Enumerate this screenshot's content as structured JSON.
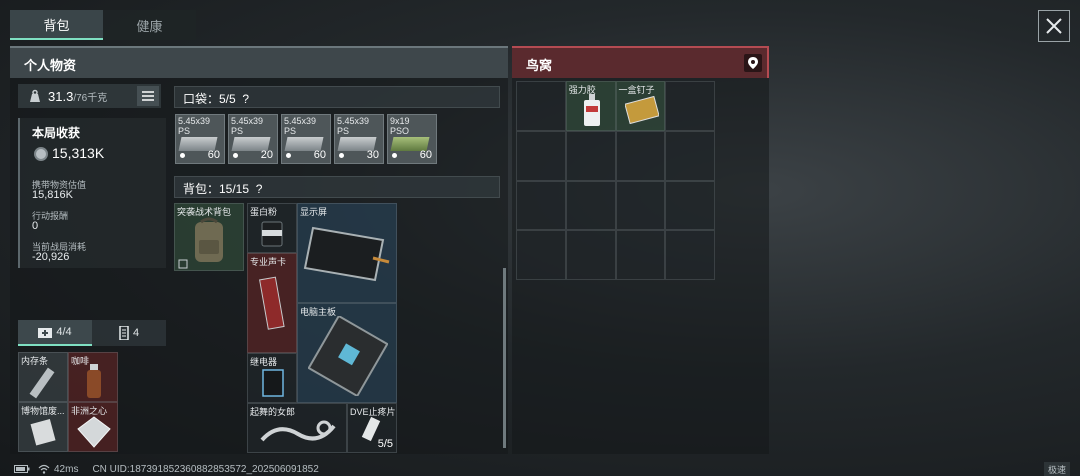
{
  "tabs": [
    {
      "label": "背包"
    },
    {
      "label": "健康"
    }
  ],
  "left_panel": {
    "title": "个人物资",
    "weight": {
      "current": "31.3",
      "max": "/76千克"
    },
    "summary": {
      "title": "本局收获",
      "value": "15,313K",
      "stats": [
        {
          "label": "携带物资估值",
          "value": "15,816K"
        },
        {
          "label": "行动报酬",
          "value": "0"
        },
        {
          "label": "当前战局消耗",
          "value": "-20,926"
        }
      ]
    },
    "slot_tabs": [
      {
        "label": "4/4",
        "icon": "medkit-icon"
      },
      {
        "label": "4",
        "icon": "magazine-icon"
      }
    ],
    "slot_items": [
      {
        "name": "内存条",
        "color": "gray"
      },
      {
        "name": "咖啡",
        "color": "red"
      },
      {
        "name": "博物馆废...",
        "color": "gray"
      },
      {
        "name": "非洲之心",
        "color": "red"
      }
    ],
    "pocket": {
      "label": "口袋：5/5",
      "help": "?"
    },
    "ammo": [
      {
        "name": "5.45x39\nPS",
        "count": "60",
        "color": "silver"
      },
      {
        "name": "5.45x39\nPS",
        "count": "20",
        "color": "silver"
      },
      {
        "name": "5.45x39\nPS",
        "count": "60",
        "color": "silver"
      },
      {
        "name": "5.45x39\nPS",
        "count": "30",
        "color": "silver"
      },
      {
        "name": "9x19\nPSO",
        "count": "60",
        "color": "green"
      }
    ],
    "backpack": {
      "label": "背包：15/15",
      "help": "?",
      "item": "突袭战术背包"
    },
    "backpack_items": [
      {
        "name": "蛋白粉"
      },
      {
        "name": "显示屏"
      },
      {
        "name": "专业声卡"
      },
      {
        "name": "电脑主板"
      },
      {
        "name": "继电器"
      },
      {
        "name": "起舞的女郎"
      },
      {
        "name": "DVE止疼片",
        "count": "5/5"
      }
    ]
  },
  "right_panel": {
    "title": "鸟窝",
    "items": [
      {
        "name": "强力胶"
      },
      {
        "name": "一盒钉子"
      }
    ]
  },
  "status_bar": {
    "ping": "42ms",
    "uid": "CN UID:1873918523608828535​72_202506091852",
    "speed_label": "极速"
  },
  "colors": {
    "accent": "#7fe0c2",
    "red_panel": "#b44b52"
  }
}
